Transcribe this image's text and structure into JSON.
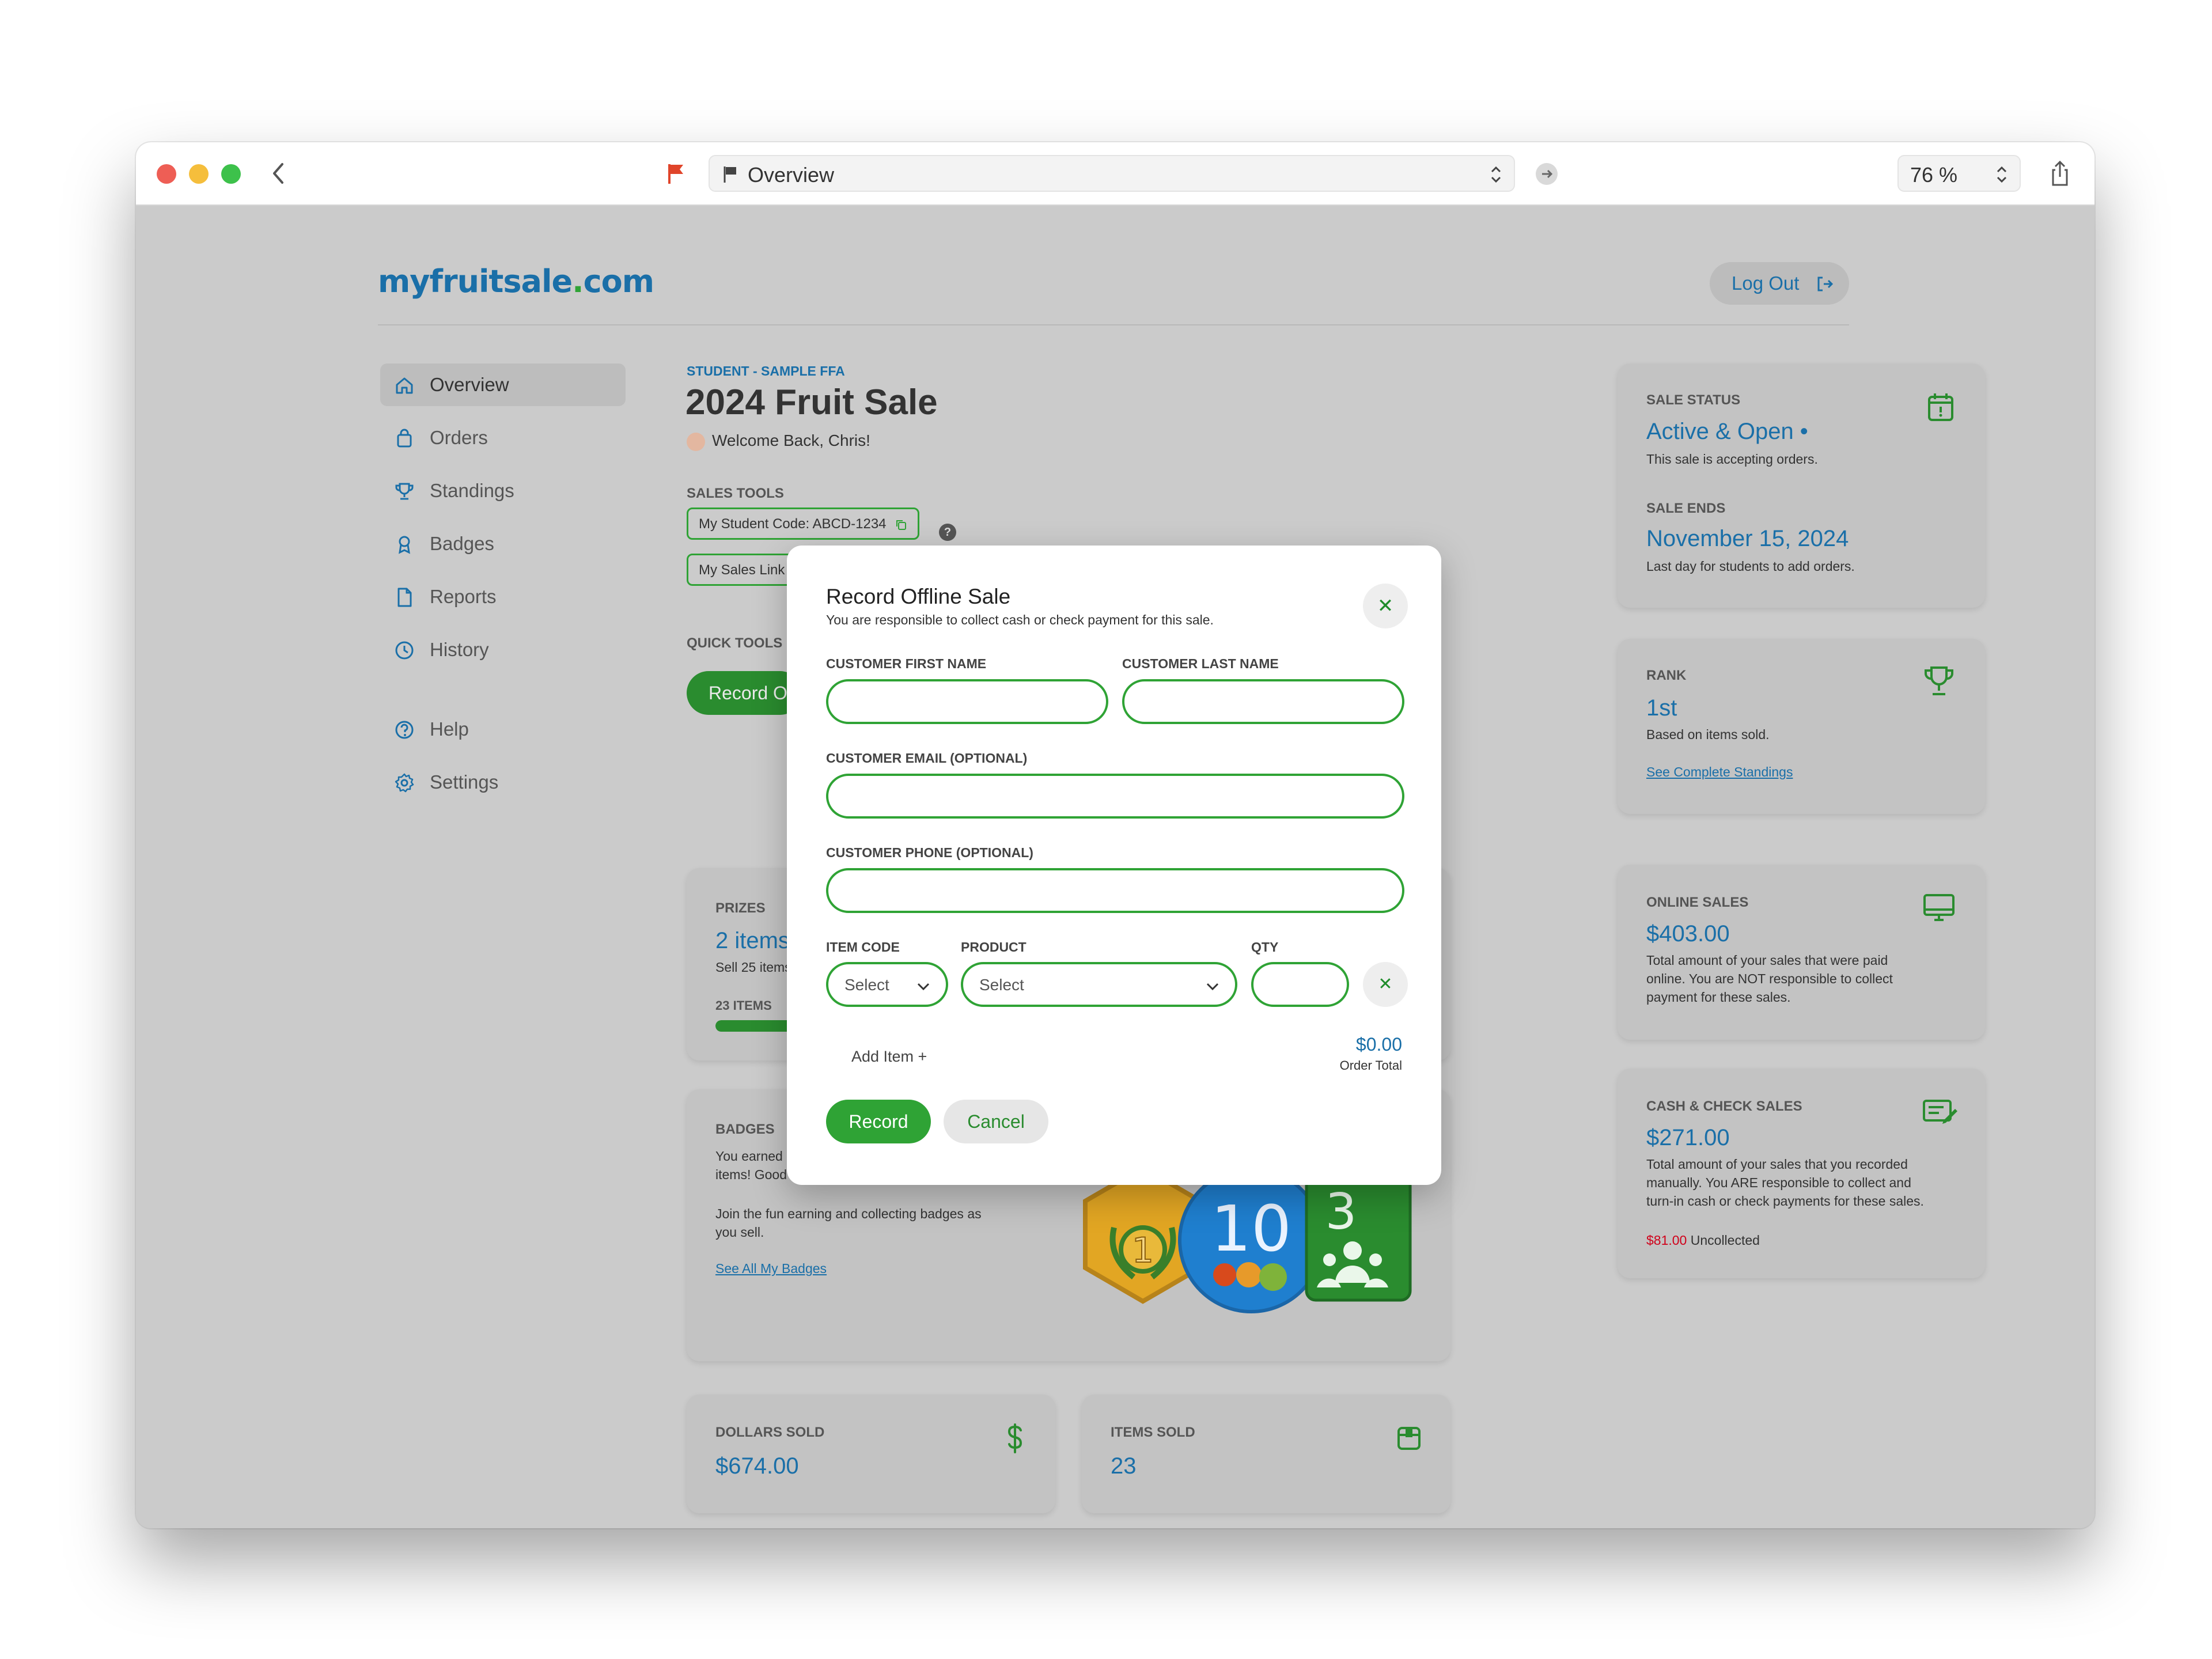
{
  "browser": {
    "url_title": "Overview",
    "zoom": "76 %"
  },
  "site": {
    "logo_main": "myfruitsale",
    "logo_dot": ".",
    "logo_tld": "com",
    "logout_label": "Log Out"
  },
  "nav": {
    "items": [
      {
        "label": "Overview",
        "icon": "home-icon",
        "active": true
      },
      {
        "label": "Orders",
        "icon": "bag-icon"
      },
      {
        "label": "Standings",
        "icon": "trophy-icon"
      },
      {
        "label": "Badges",
        "icon": "award-icon"
      },
      {
        "label": "Reports",
        "icon": "document-icon"
      },
      {
        "label": "History",
        "icon": "clock-icon"
      },
      {
        "label": "Help",
        "icon": "help-icon"
      },
      {
        "label": "Settings",
        "icon": "gear-icon"
      }
    ]
  },
  "header": {
    "eyebrow": "STUDENT - SAMPLE FFA",
    "title": "2024 Fruit Sale",
    "welcome": "Welcome Back, Chris!"
  },
  "sales_tools": {
    "label": "SALES TOOLS",
    "student_code": "My Student Code: ABCD-1234",
    "sales_link": "My Sales Link",
    "help": "?"
  },
  "quick_tools": {
    "label": "QUICK TOOLS",
    "record_button": "Record Offline Sale"
  },
  "prizes_card": {
    "label": "PRIZES",
    "value": "2 items",
    "desc": "Sell 25 items",
    "progress_label": "23 ITEMS",
    "progress_fraction": 0.92
  },
  "badges_card": {
    "label": "BADGES",
    "desc_line1": "You earned",
    "desc_line2": "items! Good",
    "desc2_line1": "Join the fun earning and collecting badges as",
    "desc2_line2": "you sell.",
    "link": "See All My Badges",
    "badge1": "1",
    "badge2": "10",
    "badge3": "3"
  },
  "dollars_card": {
    "label": "DOLLARS SOLD",
    "value": "$674.00"
  },
  "items_card": {
    "label": "ITEMS SOLD",
    "value": "23"
  },
  "status_card": {
    "label": "SALE STATUS",
    "value": "Active & Open •",
    "desc": "This sale is accepting orders.",
    "ends_label": "SALE ENDS",
    "ends_value": "November 15, 2024",
    "ends_desc": "Last day for students to add orders."
  },
  "rank_card": {
    "label": "RANK",
    "value": "1st",
    "desc": "Based on items sold.",
    "link": "See Complete Standings"
  },
  "online_card": {
    "label": "ONLINE SALES",
    "value": "$403.00",
    "desc1": "Total amount of your sales that were paid",
    "desc2": "online. You are NOT responsible to collect",
    "desc3": "payment for these sales."
  },
  "cash_card": {
    "label": "CASH & CHECK SALES",
    "value": "$271.00",
    "desc1": "Total amount of your sales that you recorded",
    "desc2": "manually. You ARE responsible to collect and",
    "desc3": "turn-in cash or check payments for these sales.",
    "uncollected_amount": "$81.00",
    "uncollected_label": "Uncollected"
  },
  "modal": {
    "title": "Record Offline Sale",
    "subtitle": "You are responsible to collect cash or check payment for this sale.",
    "first_name_label": "CUSTOMER FIRST NAME",
    "first_name_value": "",
    "last_name_label": "CUSTOMER LAST NAME",
    "last_name_value": "",
    "email_label": "CUSTOMER EMAIL (OPTIONAL)",
    "email_value": "",
    "phone_label": "CUSTOMER PHONE (OPTIONAL)",
    "phone_value": "",
    "item_code_label": "ITEM CODE",
    "item_code_value": "Select",
    "product_label": "PRODUCT",
    "product_value": "Select",
    "qty_label": "QTY",
    "qty_value": "",
    "add_item": "Add Item +",
    "order_total": "$0.00",
    "order_total_label": "Order Total",
    "record_button": "Record",
    "cancel_button": "Cancel"
  },
  "colors": {
    "brand_blue": "#1a6fa8",
    "brand_green": "#2fa335",
    "uncollected_red": "#d0021b"
  }
}
